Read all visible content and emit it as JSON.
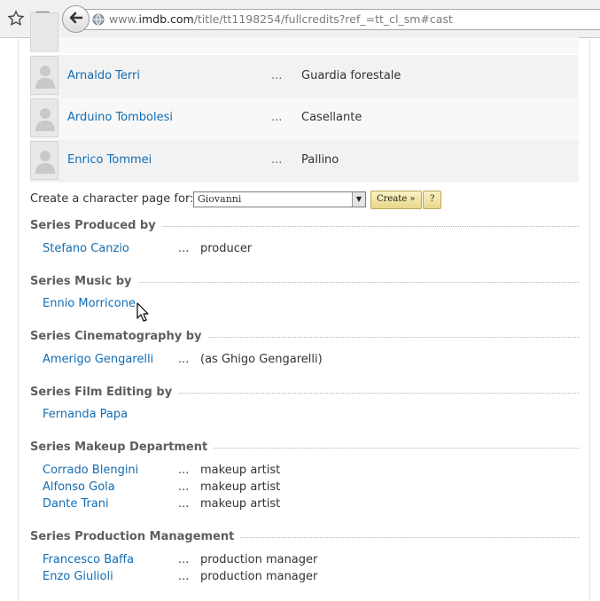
{
  "browser": {
    "url_prefix": "www.",
    "url_host": "imdb.com",
    "url_path": "/title/tt1198254/fullcredits?ref_=tt_cl_sm#cast"
  },
  "cast": [
    {
      "actor": "Arnaldo Terri",
      "dots": "...",
      "character": "Guardia forestale"
    },
    {
      "actor": "Arduino Tombolesi",
      "dots": "...",
      "character": "Casellante"
    },
    {
      "actor": "Enrico Tommei",
      "dots": "...",
      "character": "Pallino"
    }
  ],
  "create_character": {
    "label": "Create a character page for:",
    "selected": "Giovanni",
    "create_button": "Create »",
    "help_button": "?"
  },
  "sections": [
    {
      "title": "Series Produced by",
      "rows": [
        {
          "name": "Stefano Canzio",
          "dots": "...",
          "credit": "producer"
        }
      ]
    },
    {
      "title": "Series Music by",
      "rows": [
        {
          "name": "Ennio Morricone",
          "dots": "",
          "credit": ""
        }
      ]
    },
    {
      "title": "Series Cinematography by",
      "rows": [
        {
          "name": "Amerigo Gengarelli",
          "dots": "...",
          "credit": "(as Ghigo Gengarelli)"
        }
      ]
    },
    {
      "title": "Series Film Editing by",
      "rows": [
        {
          "name": "Fernanda Papa",
          "dots": "",
          "credit": ""
        }
      ]
    },
    {
      "title": "Series Makeup Department",
      "rows": [
        {
          "name": "Corrado Blengini",
          "dots": "...",
          "credit": "makeup artist"
        },
        {
          "name": "Alfonso Gola",
          "dots": "...",
          "credit": "makeup artist"
        },
        {
          "name": "Dante Trani",
          "dots": "...",
          "credit": "makeup artist"
        }
      ]
    },
    {
      "title": "Series Production Management",
      "rows": [
        {
          "name": "Francesco Baffa",
          "dots": "...",
          "credit": "production manager"
        },
        {
          "name": "Enzo Giulioli",
          "dots": "...",
          "credit": "production manager"
        }
      ]
    }
  ],
  "colors": {
    "link": "#136cb2",
    "section_title": "#5e5e5e"
  }
}
